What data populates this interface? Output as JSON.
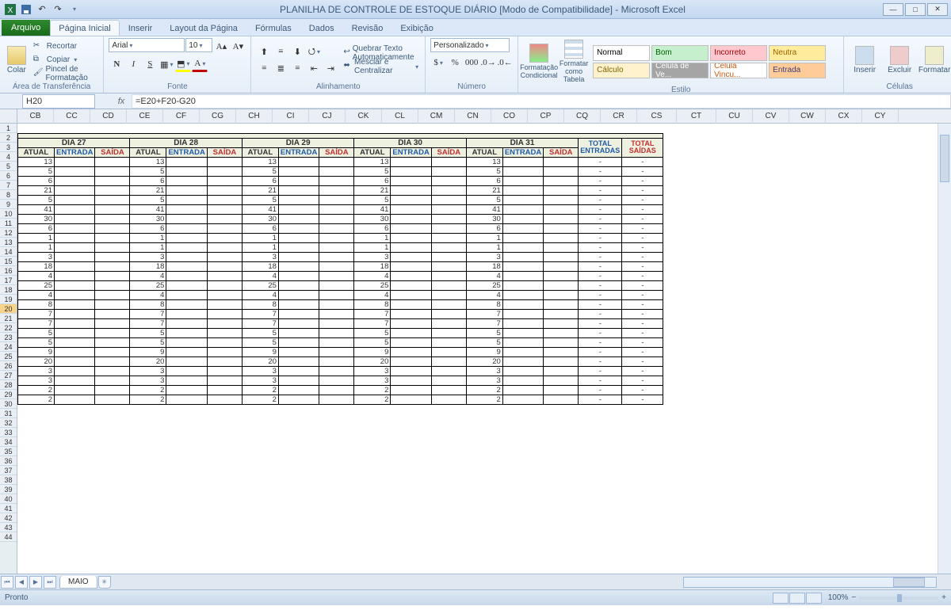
{
  "app": {
    "title": "PLANILHA DE CONTROLE DE ESTOQUE DIÁRIO  [Modo de Compatibilidade]  -  Microsoft Excel"
  },
  "ribbon": {
    "file_tab": "Arquivo",
    "tabs": [
      "Página Inicial",
      "Inserir",
      "Layout da Página",
      "Fórmulas",
      "Dados",
      "Revisão",
      "Exibição"
    ],
    "active_tab": "Página Inicial",
    "clipboard": {
      "paste": "Colar",
      "cut": "Recortar",
      "copy": "Copiar",
      "painter": "Pincel de Formatação",
      "group": "Área de Transferência"
    },
    "font": {
      "name": "Arial",
      "size": "10",
      "group": "Fonte"
    },
    "alignment": {
      "wrap": "Quebrar Texto Automaticamente",
      "merge": "Mesclar e Centralizar",
      "group": "Alinhamento"
    },
    "number": {
      "format": "Personalizado",
      "group": "Número"
    },
    "stylesgrp": {
      "cond": "Formatação Condicional",
      "table": "Formatar como Tabela",
      "group": "Estilo",
      "cells": [
        {
          "label": "Normal",
          "bg": "#ffffff",
          "fg": "#000"
        },
        {
          "label": "Bom",
          "bg": "#c6efce",
          "fg": "#006100"
        },
        {
          "label": "Incorreto",
          "bg": "#ffc7ce",
          "fg": "#9c0006"
        },
        {
          "label": "Neutra",
          "bg": "#ffeb9c",
          "fg": "#9c6500"
        },
        {
          "label": "Cálculo",
          "bg": "#fff2cc",
          "fg": "#7f6000"
        },
        {
          "label": "Célula de Ve...",
          "bg": "#a5a5a5",
          "fg": "#fff"
        },
        {
          "label": "Célula Vincu...",
          "bg": "#ffffff",
          "fg": "#c65911"
        },
        {
          "label": "Entrada",
          "bg": "#ffcc99",
          "fg": "#3f3f76"
        }
      ]
    },
    "cells": {
      "insert": "Inserir",
      "delete": "Excluir",
      "format": "Formatar",
      "group": "Células"
    }
  },
  "formula_bar": {
    "name": "H20",
    "formula": "=E20+F20-G20"
  },
  "columns": [
    "CB",
    "CC",
    "CD",
    "CE",
    "CF",
    "CG",
    "CH",
    "CI",
    "CJ",
    "CK",
    "CL",
    "CM",
    "CN",
    "CO",
    "CP",
    "CQ",
    "CR",
    "CS",
    "CT",
    "CU",
    "CV",
    "CW",
    "CX",
    "CY"
  ],
  "row_numbers": [
    1,
    2,
    3,
    4,
    5,
    6,
    7,
    8,
    9,
    10,
    11,
    12,
    13,
    14,
    15,
    16,
    17,
    18,
    19,
    20,
    21,
    22,
    23,
    24,
    25,
    26,
    27,
    28,
    29,
    30,
    31,
    32,
    33,
    34,
    35,
    36,
    37,
    38,
    39,
    40,
    41,
    42,
    43,
    44
  ],
  "selected_row": 20,
  "days": [
    "DIA 27",
    "DIA 28",
    "DIA 29",
    "DIA 30",
    "DIA 31"
  ],
  "sub_headers": {
    "atual": "ATUAL",
    "entrada": "ENTRADA",
    "saida": "SAÍDA"
  },
  "totals": {
    "entradas": "TOTAL ENTRADAS",
    "saidas": "TOTAL SAÍDAS"
  },
  "atual_values": [
    13,
    5,
    6,
    21,
    5,
    41,
    30,
    6,
    1,
    1,
    3,
    18,
    4,
    25,
    4,
    8,
    7,
    7,
    5,
    5,
    9,
    20,
    3,
    3,
    2,
    2
  ],
  "dash": "-",
  "sheet_tab": "MAIO",
  "status": {
    "ready": "Pronto",
    "zoom": "100%"
  },
  "chart_data": {
    "type": "table",
    "title": "PLANILHA DE CONTROLE DE ESTOQUE DIÁRIO",
    "columns": [
      "DIA 27 ATUAL",
      "DIA 27 ENTRADA",
      "DIA 27 SAÍDA",
      "DIA 28 ATUAL",
      "DIA 28 ENTRADA",
      "DIA 28 SAÍDA",
      "DIA 29 ATUAL",
      "DIA 29 ENTRADA",
      "DIA 29 SAÍDA",
      "DIA 30 ATUAL",
      "DIA 30 ENTRADA",
      "DIA 30 SAÍDA",
      "DIA 31 ATUAL",
      "DIA 31 ENTRADA",
      "DIA 31 SAÍDA",
      "TOTAL ENTRADAS",
      "TOTAL SAÍDAS"
    ],
    "atual_series": [
      13,
      5,
      6,
      21,
      5,
      41,
      30,
      6,
      1,
      1,
      3,
      18,
      4,
      25,
      4,
      8,
      7,
      7,
      5,
      5,
      9,
      20,
      3,
      3,
      2,
      2
    ]
  }
}
